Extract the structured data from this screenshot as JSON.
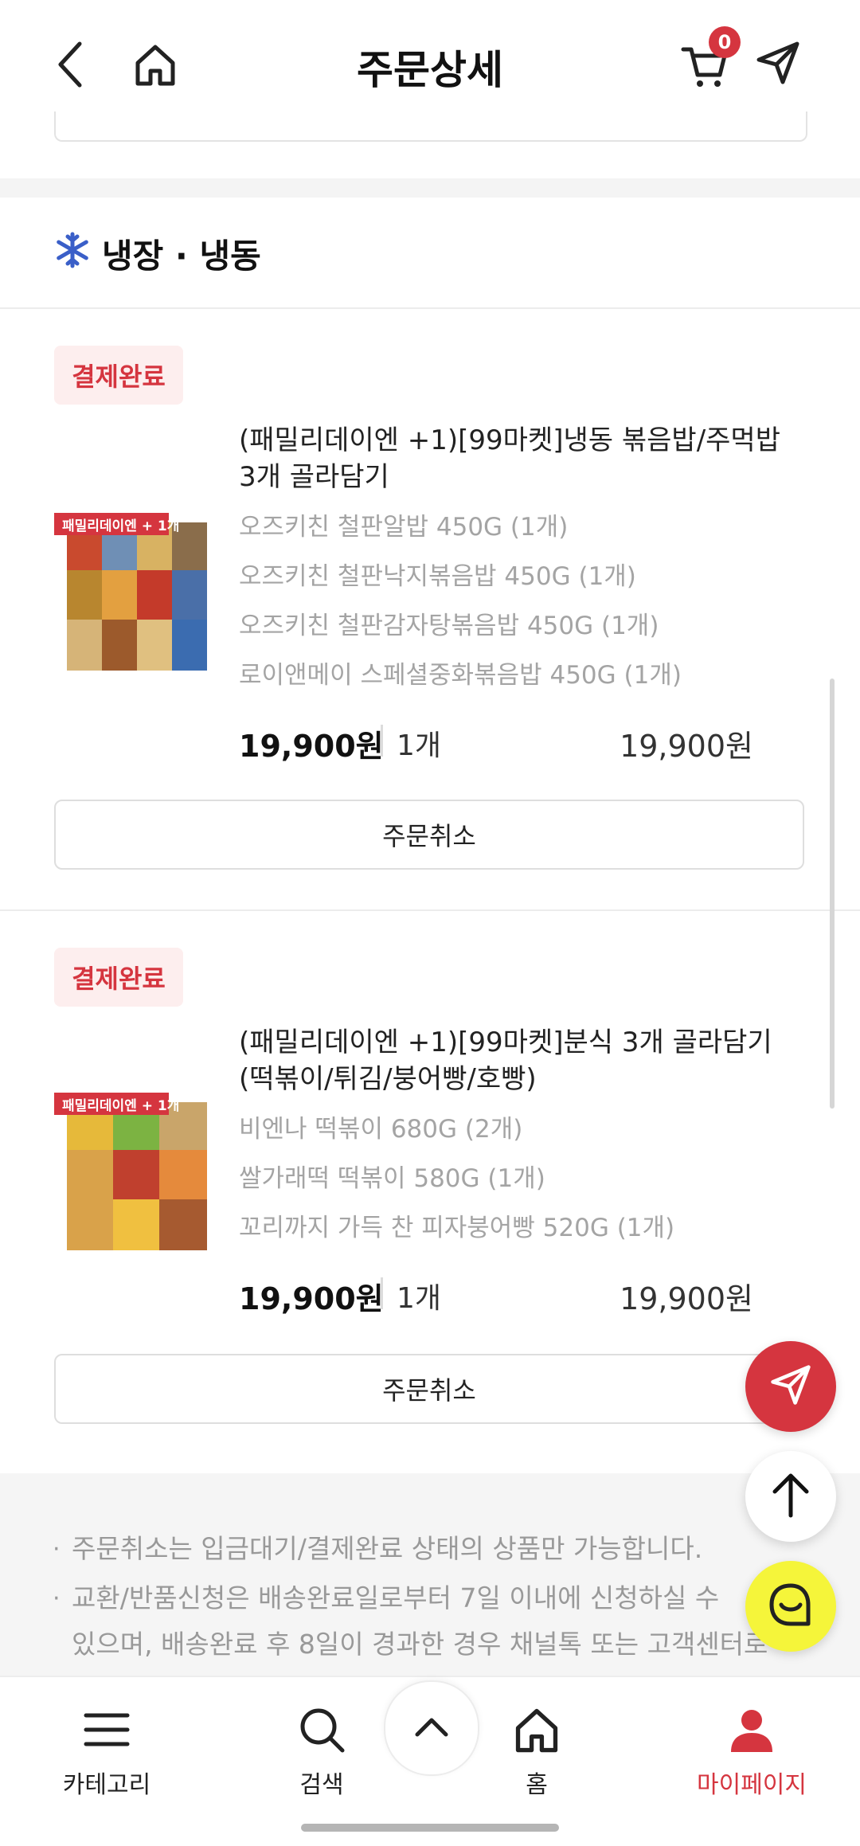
{
  "header": {
    "title": "주문상세",
    "cart_count": "0",
    "icons": [
      "back-arrow-icon",
      "home-icon",
      "cart-icon",
      "share-send-icon"
    ]
  },
  "section": {
    "title": "냉장 · 냉동",
    "icon": "snowflake-icon"
  },
  "orders": [
    {
      "status": "결제완료",
      "title": "(패밀리데이엔 +1)[99마켓]냉동 볶음밥/주먹밥 3개 골라담기",
      "image_banner": "패밀리데이엔 + 1개",
      "options": [
        "오즈키친 철판알밥 450G (1개)",
        "오즈키친 철판낙지볶음밥 450G (1개)",
        "오즈키친 철판감자탕볶음밥 450G (1개)",
        "로이앤메이 스페셜중화볶음밥 450G (1개)"
      ],
      "price": "19,900원",
      "qty": "1개",
      "total": "19,900원",
      "cancel_label": "주문취소"
    },
    {
      "status": "결제완료",
      "title": "(패밀리데이엔 +1)[99마켓]분식 3개 골라담기 (떡볶이/튀김/붕어빵/호빵)",
      "image_banner": "패밀리데이엔 + 1개",
      "options": [
        "비엔나 떡볶이 680G (2개)",
        "쌀가래떡 떡볶이 580G (1개)",
        "꼬리까지 가득 찬 피자붕어빵 520G (1개)"
      ],
      "price": "19,900원",
      "qty": "1개",
      "total": "19,900원",
      "cancel_label": "주문취소"
    }
  ],
  "notices": [
    "주문취소는 입금대기/결제완료 상태의 상품만 가능합니다.",
    "교환/반품신청은 배송완료일로부터 7일 이내에 신청하실 수",
    "있으며, 배송완료 후 8일이 경과한 경우 채널톡 또는 고객센터로"
  ],
  "fabs": [
    "share-send-icon",
    "scroll-top-arrow-icon",
    "chat-smile-icon"
  ],
  "bottom_nav": {
    "items": [
      {
        "label": "카테고리",
        "icon": "menu-icon"
      },
      {
        "label": "검색",
        "icon": "search-icon"
      },
      {
        "label": "",
        "icon": "chevron-up-icon"
      },
      {
        "label": "홈",
        "icon": "home-icon"
      },
      {
        "label": "마이페이지",
        "icon": "user-icon"
      }
    ],
    "active": "마이페이지"
  },
  "colors": {
    "accent": "#d5353f",
    "badge_bg": "#fdeeee",
    "option_text": "#a4a4a4",
    "chat_fab": "#f5f53a"
  }
}
